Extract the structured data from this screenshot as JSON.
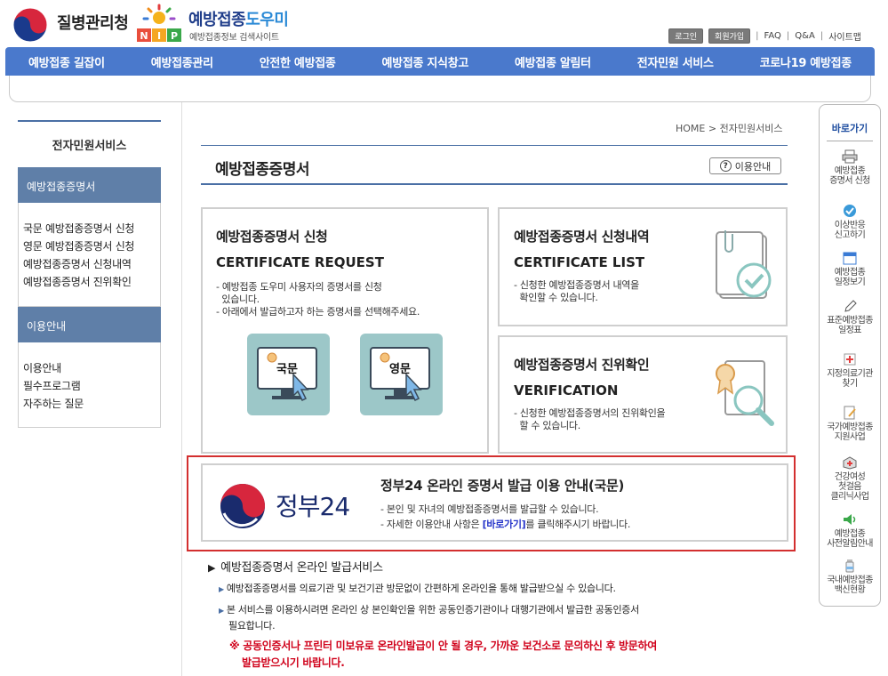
{
  "header": {
    "agency_name": "질병관리청",
    "site_name_a": "예방접종",
    "site_name_b": "도우미",
    "site_sub": "예방접종정보 검색사이트",
    "nip_letters": [
      "N",
      "I",
      "P"
    ],
    "util": {
      "login": "로그인",
      "join": "회원가입",
      "faq": "FAQ",
      "qna": "Q&A",
      "sitemap": "사이트맵"
    }
  },
  "nav": {
    "items": [
      "예방접종 길잡이",
      "예방접종관리",
      "안전한 예방접종",
      "예방접종 지식창고",
      "예방접종 알림터",
      "전자민원 서비스",
      "코로나19 예방접종"
    ]
  },
  "sidebar": {
    "title": "전자민원서비스",
    "section1": "예방접종증명서",
    "links1": [
      "국문 예방접종증명서 신청",
      "영문 예방접종증명서 신청",
      "예방접종증명서 신청내역",
      "예방접종증명서 진위확인"
    ],
    "section2": "이용안내",
    "links2": [
      "이용안내",
      "필수프로그램",
      "자주하는 질문"
    ]
  },
  "main": {
    "breadcrumb_home": "HOME",
    "breadcrumb_current": "전자민원서비스",
    "page_title": "예방접종증명서",
    "guide_button": "이용안내",
    "guide_q": "?",
    "card_request": {
      "title": "예방접종증명서 신청",
      "en": "CERTIFICATE REQUEST",
      "desc1": "- 예방접종 도우미 사용자의 증명서를 신청",
      "desc1b": "  있습니다.",
      "desc2": "- 아래에서 발급하고자 하는 증명서를 선택해주세요.",
      "korean_btn": "국문",
      "english_btn": "영문"
    },
    "card_list": {
      "title": "예방접종증명서 신청내역",
      "en": "CERTIFICATE LIST",
      "desc1": "- 신청한 예방접종증명서 내역을",
      "desc1b": "  확인할 수 있습니다."
    },
    "card_verify": {
      "title": "예방접종증명서 진위확인",
      "en": "VERIFICATION",
      "desc1": "- 신청한 예방접종증명서의 진위확인을",
      "desc1b": "  할 수 있습니다."
    },
    "gov24": {
      "logo_text": "정부24",
      "title": "정부24 온라인 증명서 발급 이용 안내(국문)",
      "desc1": "- 본인 및 자녀의 예방접종증명서를 발급할 수 있습니다.",
      "desc2_pre": "- 자세한 이용안내 사항은 ",
      "desc2_link": "[바로가기]",
      "desc2_post": "를 클릭해주시기 바랍니다."
    },
    "online": {
      "title": "예방접종증명서 온라인 발급서비스",
      "line1": "예방접종증명서를 의료기관 및 보건기관 방문없이 간편하게 온라인을 통해 발급받으실 수 있습니다.",
      "line2a": "본 서비스를 이용하시려면 온라인 상 본인확인을 위한 공동인증기관이나 대행기관에서 발급한 공동인증서",
      "line2b": "필요합니다.",
      "warn1": "※ 공동인증서나 프린터 미보유로 온라인발급이 안 될 경우, 가까운 보건소로 문의하신 후 방문하여",
      "warn2": "발급받으시기 바랍니다."
    }
  },
  "quick": {
    "title": "바로가기",
    "items": [
      [
        "예방접종",
        "증명서 신청"
      ],
      [
        "이상반응",
        "신고하기"
      ],
      [
        "예방접종",
        "일정보기"
      ],
      [
        "표준예방접종",
        "일정표"
      ],
      [
        "지정의료기관",
        "찾기"
      ],
      [
        "국가예방접종",
        "지원사업"
      ],
      [
        "건강여성",
        "첫걸음",
        "클리닉사업"
      ],
      [
        "예방접종",
        "사전알림안내"
      ],
      [
        "국내예방접종",
        "백신현황"
      ]
    ]
  },
  "colors": {
    "nav": "#4a79cc",
    "sidebar_head": "#5f7fa8",
    "accent_line": "#4a6fa5",
    "gov_frame": "#d32f2f",
    "warn": "#d0021b",
    "cert_btn": "#9cc7c8"
  }
}
